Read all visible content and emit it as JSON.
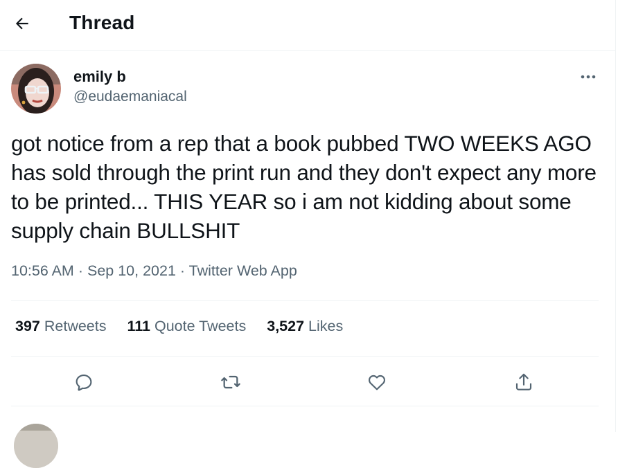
{
  "header": {
    "title": "Thread",
    "back_icon": "arrow-left-icon"
  },
  "tweet": {
    "author": {
      "name": "emily b",
      "handle": "@eudaemaniacal"
    },
    "more_icon": "more-horizontal-icon",
    "text": "got notice from a rep that a book pubbed TWO WEEKS AGO has sold through the print run and they don't expect any more to be printed... THIS YEAR so i am not kidding about some supply chain BULLSHIT",
    "time": "10:56 AM",
    "date": "Sep 10, 2021",
    "source": "Twitter Web App",
    "separator": "·",
    "stats": [
      {
        "count": "397",
        "label": "Retweets"
      },
      {
        "count": "111",
        "label": "Quote Tweets"
      },
      {
        "count": "3,527",
        "label": "Likes"
      }
    ],
    "actions": [
      "reply-icon",
      "retweet-icon",
      "like-icon",
      "share-icon"
    ]
  },
  "colors": {
    "text": "#0f1419",
    "secondary": "#536471",
    "divider": "#eff3f4"
  }
}
